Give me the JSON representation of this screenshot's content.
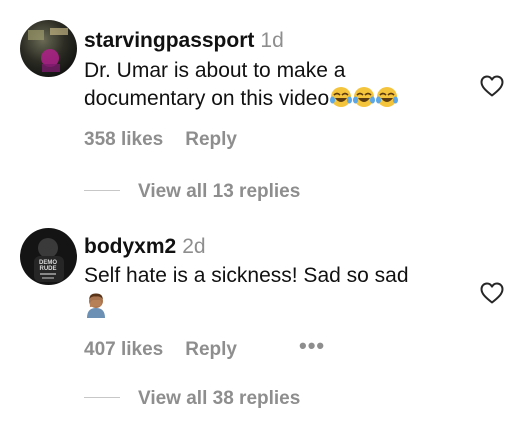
{
  "comments": [
    {
      "username": "starvingpassport",
      "time": "1d",
      "text_line1": "Dr. Umar is about to make a",
      "text_line2": "documentary on this video",
      "emoji": "face-with-tears-of-joy x3",
      "likes": "358 likes",
      "reply_label": "Reply",
      "view_replies": "View all 13 replies"
    },
    {
      "username": "bodyxm2",
      "time": "2d",
      "text_line1": "Self hate is a sickness! Sad so sad",
      "emoji": "man-facepalming-medium-skin-tone",
      "likes": "407 likes",
      "reply_label": "Reply",
      "more_label": "•••",
      "view_replies": "View all 38 replies"
    }
  ],
  "colors": {
    "text": "#111111",
    "secondary": "#8e8e8e",
    "divider": "#c7c7c7",
    "emoji_yellow": "#f4c43c"
  },
  "icons": {
    "like": "heart-outline-icon",
    "more": "more-options-icon"
  }
}
